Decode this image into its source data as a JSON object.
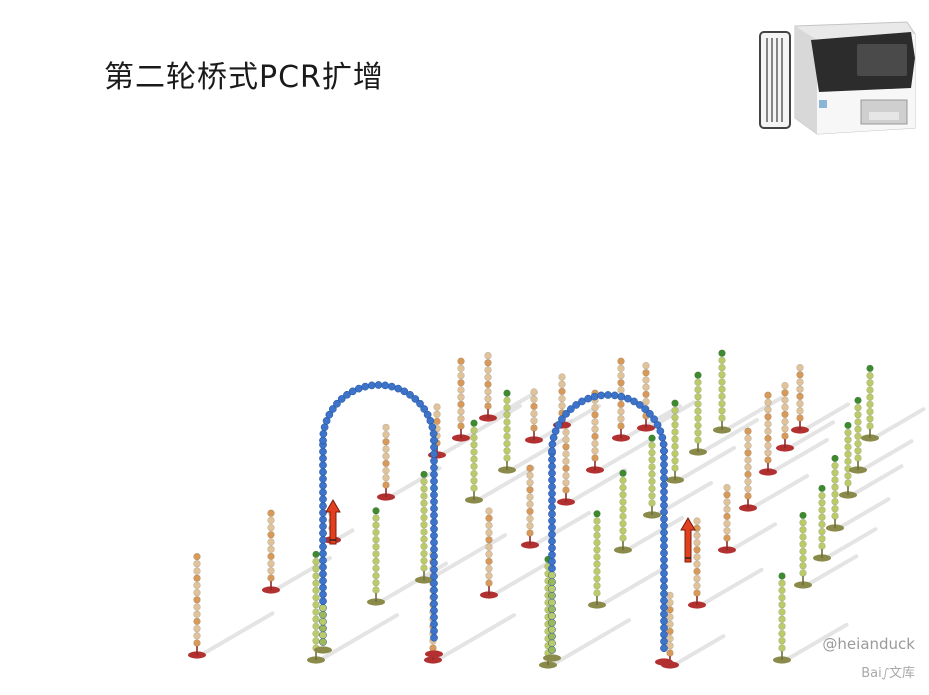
{
  "slide": {
    "title": "第二轮桥式PCR扩增"
  },
  "watermark": {
    "handle": "@heianduck",
    "brand_left": "Bai",
    "brand_paw": "ഽ",
    "brand_right": "文库"
  },
  "colors": {
    "background": "#ffffff",
    "bridge_strand": "#3d74c9",
    "primer_bead_tan": "#e0c39a",
    "primer_bead_orange": "#d79a5a",
    "primer_bead_olive": "#bccb6a",
    "primer_tip_green": "#3e8a2e",
    "anchor_red": "#b23030",
    "anchor_olive": "#8a8a4a",
    "arrow_red": "#e0401e"
  },
  "icons": [
    "sequencer-instrument-icon",
    "primer-strand-icon",
    "extension-arrow-icon",
    "baidu-paw-icon"
  ]
}
